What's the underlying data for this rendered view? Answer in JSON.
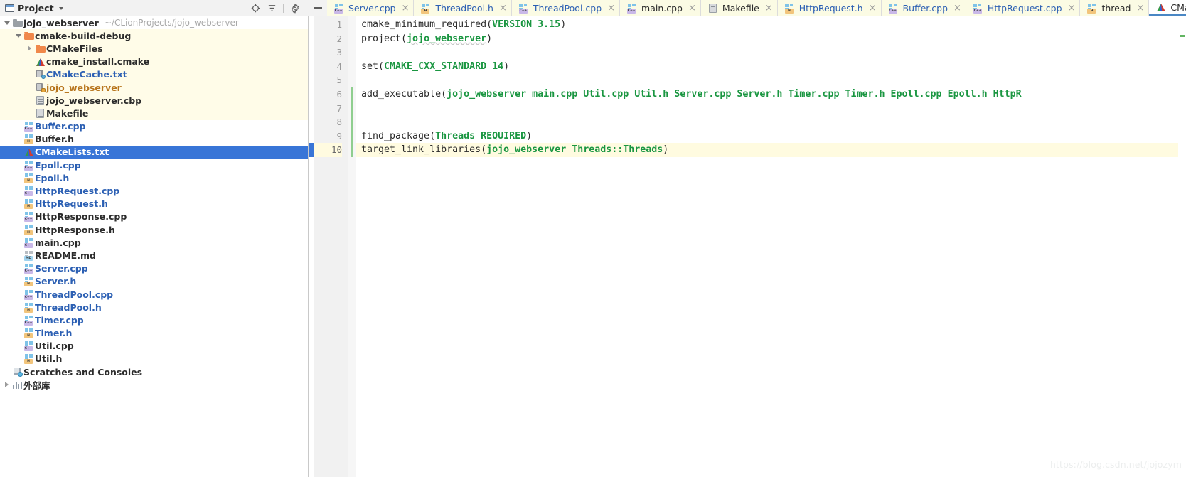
{
  "project_panel": {
    "title": "Project",
    "window_icon": "project-window-icon",
    "dropdown_icon": "chevron-down-icon",
    "tools": [
      {
        "name": "locate-icon",
        "label": "Select Opened File"
      },
      {
        "name": "collapse-all-icon",
        "label": "Collapse All"
      },
      {
        "name": "gear-icon",
        "label": "Settings"
      }
    ],
    "tree": [
      {
        "label": "jojo_webserver",
        "path": "~/CLionProjects/jojo_webserver",
        "icon": "folder-grey-icon",
        "indent": 0,
        "arrow": "down",
        "style": "bold",
        "highlight": "none"
      },
      {
        "label": "cmake-build-debug",
        "path": "",
        "icon": "folder-orange-icon",
        "indent": 1,
        "arrow": "down",
        "style": "bold",
        "highlight": "build"
      },
      {
        "label": "CMakeFiles",
        "path": "",
        "icon": "folder-orange-icon",
        "indent": 2,
        "arrow": "right",
        "style": "bold",
        "highlight": "build"
      },
      {
        "label": "cmake_install.cmake",
        "path": "",
        "icon": "cmake-icon",
        "indent": 2,
        "arrow": "none",
        "style": "bold",
        "highlight": "build"
      },
      {
        "label": "CMakeCache.txt",
        "path": "",
        "icon": "cmake-cache-icon",
        "indent": 2,
        "arrow": "none",
        "style": "blue-bold",
        "highlight": "build"
      },
      {
        "label": "jojo_webserver",
        "path": "",
        "icon": "cmake-cache-unknown-icon",
        "indent": 2,
        "arrow": "none",
        "style": "orange-bold",
        "highlight": "build"
      },
      {
        "label": "jojo_webserver.cbp",
        "path": "",
        "icon": "doc-icon",
        "indent": 2,
        "arrow": "none",
        "style": "bold",
        "highlight": "build"
      },
      {
        "label": "Makefile",
        "path": "",
        "icon": "doc-icon",
        "indent": 2,
        "arrow": "none",
        "style": "bold",
        "highlight": "build"
      },
      {
        "label": "Buffer.cpp",
        "path": "",
        "icon": "cpp-file-icon",
        "indent": 1,
        "arrow": "none",
        "style": "blue-bold",
        "highlight": "none"
      },
      {
        "label": "Buffer.h",
        "path": "",
        "icon": "h-file-icon",
        "indent": 1,
        "arrow": "none",
        "style": "bold",
        "highlight": "none"
      },
      {
        "label": "CMakeLists.txt",
        "path": "",
        "icon": "cmake-icon",
        "indent": 1,
        "arrow": "none",
        "style": "bold",
        "highlight": "selected"
      },
      {
        "label": "Epoll.cpp",
        "path": "",
        "icon": "cpp-file-icon",
        "indent": 1,
        "arrow": "none",
        "style": "blue-bold",
        "highlight": "none"
      },
      {
        "label": "Epoll.h",
        "path": "",
        "icon": "h-file-icon",
        "indent": 1,
        "arrow": "none",
        "style": "blue-bold",
        "highlight": "none"
      },
      {
        "label": "HttpRequest.cpp",
        "path": "",
        "icon": "cpp-file-icon",
        "indent": 1,
        "arrow": "none",
        "style": "blue-bold",
        "highlight": "none"
      },
      {
        "label": "HttpRequest.h",
        "path": "",
        "icon": "h-file-icon",
        "indent": 1,
        "arrow": "none",
        "style": "blue-bold",
        "highlight": "none"
      },
      {
        "label": "HttpResponse.cpp",
        "path": "",
        "icon": "cpp-file-icon",
        "indent": 1,
        "arrow": "none",
        "style": "bold",
        "highlight": "none"
      },
      {
        "label": "HttpResponse.h",
        "path": "",
        "icon": "h-file-icon",
        "indent": 1,
        "arrow": "none",
        "style": "bold",
        "highlight": "none"
      },
      {
        "label": "main.cpp",
        "path": "",
        "icon": "cpp-file-icon",
        "indent": 1,
        "arrow": "none",
        "style": "bold",
        "highlight": "none"
      },
      {
        "label": "README.md",
        "path": "",
        "icon": "md-file-icon",
        "indent": 1,
        "arrow": "none",
        "style": "bold",
        "highlight": "none"
      },
      {
        "label": "Server.cpp",
        "path": "",
        "icon": "cpp-file-icon",
        "indent": 1,
        "arrow": "none",
        "style": "blue-bold",
        "highlight": "none"
      },
      {
        "label": "Server.h",
        "path": "",
        "icon": "h-file-icon",
        "indent": 1,
        "arrow": "none",
        "style": "blue-bold",
        "highlight": "none"
      },
      {
        "label": "ThreadPool.cpp",
        "path": "",
        "icon": "cpp-file-icon",
        "indent": 1,
        "arrow": "none",
        "style": "blue-bold",
        "highlight": "none"
      },
      {
        "label": "ThreadPool.h",
        "path": "",
        "icon": "h-file-icon",
        "indent": 1,
        "arrow": "none",
        "style": "blue-bold",
        "highlight": "none"
      },
      {
        "label": "Timer.cpp",
        "path": "",
        "icon": "cpp-file-icon",
        "indent": 1,
        "arrow": "none",
        "style": "blue-bold",
        "highlight": "none"
      },
      {
        "label": "Timer.h",
        "path": "",
        "icon": "h-file-icon",
        "indent": 1,
        "arrow": "none",
        "style": "blue-bold",
        "highlight": "none"
      },
      {
        "label": "Util.cpp",
        "path": "",
        "icon": "cpp-file-icon",
        "indent": 1,
        "arrow": "none",
        "style": "bold",
        "highlight": "none"
      },
      {
        "label": "Util.h",
        "path": "",
        "icon": "h-file-icon",
        "indent": 1,
        "arrow": "none",
        "style": "bold",
        "highlight": "none"
      },
      {
        "label": "Scratches and Consoles",
        "path": "",
        "icon": "scratches-icon",
        "indent": 0,
        "arrow": "none",
        "style": "bold",
        "highlight": "none"
      },
      {
        "label": "外部库",
        "path": "",
        "icon": "external-libraries-icon",
        "indent": 0,
        "arrow": "right",
        "style": "bold",
        "highlight": "none"
      }
    ]
  },
  "editor": {
    "hide_button": "hide-tool-window-button",
    "tabs": [
      {
        "label": "Server.cpp",
        "icon": "cpp-file-icon",
        "state": "modified",
        "color": "blue",
        "close": "×"
      },
      {
        "label": "ThreadPool.h",
        "icon": "h-file-icon",
        "state": "modified",
        "color": "blue",
        "close": "×"
      },
      {
        "label": "ThreadPool.cpp",
        "icon": "cpp-file-icon",
        "state": "modified",
        "color": "blue",
        "close": "×"
      },
      {
        "label": "main.cpp",
        "icon": "cpp-file-icon",
        "state": "modified",
        "color": "black",
        "close": "×"
      },
      {
        "label": "Makefile",
        "icon": "doc-icon",
        "state": "modified",
        "color": "black",
        "close": "×"
      },
      {
        "label": "HttpRequest.h",
        "icon": "h-file-icon",
        "state": "modified",
        "color": "blue",
        "close": "×"
      },
      {
        "label": "Buffer.cpp",
        "icon": "cpp-file-icon",
        "state": "modified",
        "color": "blue",
        "close": "×"
      },
      {
        "label": "HttpRequest.cpp",
        "icon": "cpp-file-icon",
        "state": "modified",
        "color": "blue",
        "close": "×"
      },
      {
        "label": "thread",
        "icon": "h-file-icon",
        "state": "modified",
        "color": "black",
        "close": "×"
      },
      {
        "label": "CMakeLists.txt",
        "icon": "cmake-icon",
        "state": "active",
        "color": "blue",
        "close": "×"
      }
    ],
    "line_numbers": [
      "1",
      "2",
      "3",
      "4",
      "5",
      "6",
      "7",
      "8",
      "9",
      "10"
    ],
    "current_line": 10,
    "lines": [
      {
        "n": 1,
        "segments": [
          {
            "t": "cmake_minimum_required(",
            "c": "kw"
          },
          {
            "t": "VERSION 3.15",
            "c": "arg"
          },
          {
            "t": ")",
            "c": "kw"
          }
        ]
      },
      {
        "n": 2,
        "segments": [
          {
            "t": "project(",
            "c": "kw"
          },
          {
            "t": "jojo_webserver",
            "c": "arg-u"
          },
          {
            "t": ")",
            "c": "kw"
          }
        ]
      },
      {
        "n": 3,
        "segments": [
          {
            "t": "",
            "c": "kw"
          }
        ]
      },
      {
        "n": 4,
        "segments": [
          {
            "t": "set(",
            "c": "kw"
          },
          {
            "t": "CMAKE_CXX_STANDARD 14",
            "c": "arg"
          },
          {
            "t": ")",
            "c": "kw"
          }
        ]
      },
      {
        "n": 5,
        "segments": [
          {
            "t": "",
            "c": "kw"
          }
        ]
      },
      {
        "n": 6,
        "segments": [
          {
            "t": "add_executable(",
            "c": "kw"
          },
          {
            "t": "jojo_webserver main.cpp Util.cpp Util.h Server.cpp Server.h Timer.cpp Timer.h Epoll.cpp Epoll.h HttpR",
            "c": "arg"
          }
        ]
      },
      {
        "n": 7,
        "segments": [
          {
            "t": "",
            "c": "kw"
          }
        ]
      },
      {
        "n": 8,
        "segments": [
          {
            "t": "",
            "c": "kw"
          }
        ]
      },
      {
        "n": 9,
        "segments": [
          {
            "t": "find_package(",
            "c": "kw"
          },
          {
            "t": "Threads REQUIRED",
            "c": "arg"
          },
          {
            "t": ")",
            "c": "kw"
          }
        ]
      },
      {
        "n": 10,
        "segments": [
          {
            "t": "target_link_libraries(",
            "c": "kw"
          },
          {
            "t": "jojo_webserver Threads::Threads",
            "c": "arg"
          },
          {
            "t": ")",
            "c": "kw"
          }
        ]
      }
    ],
    "watermark": "https://blog.csdn.net/jojozym"
  },
  "colors": {
    "selection_blue": "#3875d7",
    "build_folder_highlight": "#fffce8",
    "current_line_highlight": "#fffbe0",
    "cmake_arg_green": "#1a9641",
    "tab_modified_bg": "#fbfbe4",
    "link_blue": "#2b5fb3",
    "orange_label": "#b8761e",
    "change_marker_green": "#8fce8f"
  }
}
